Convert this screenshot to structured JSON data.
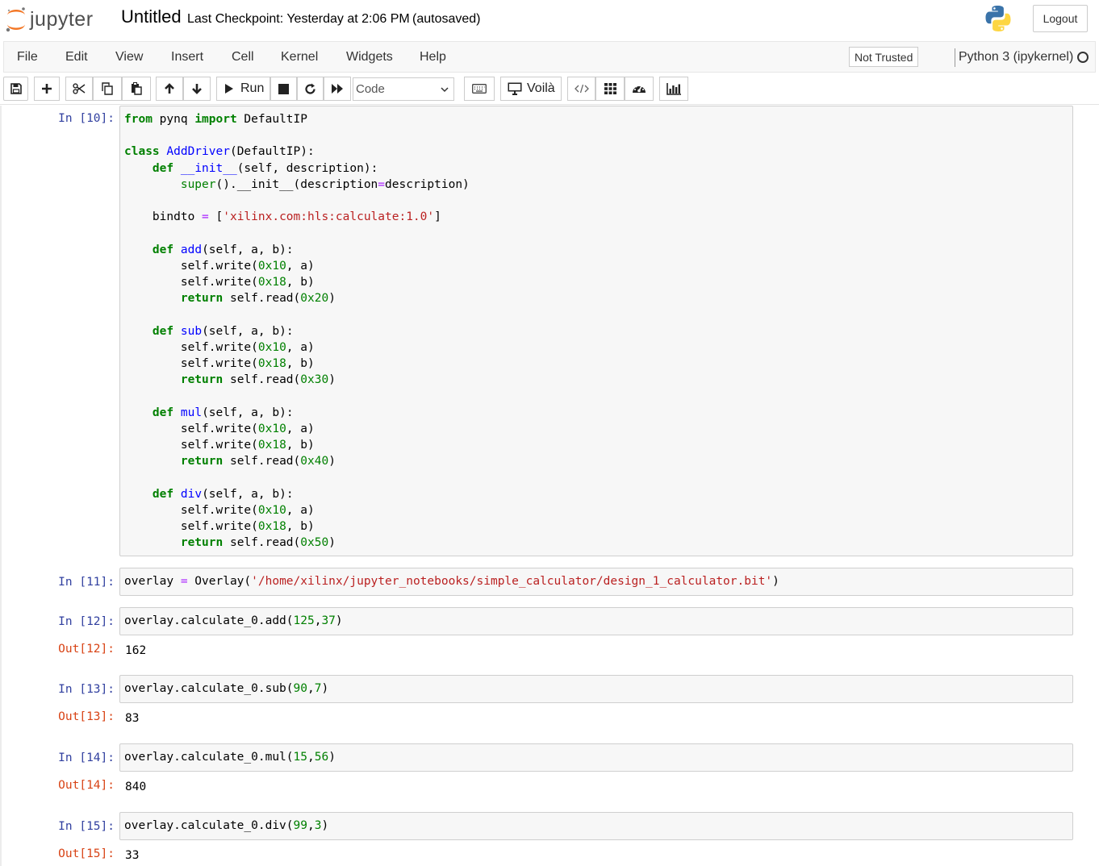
{
  "header": {
    "logo_text": "jupyter",
    "notebook_title": "Untitled",
    "checkpoint": "Last Checkpoint: Yesterday at 2:06 PM",
    "autosave": "(autosaved)",
    "logout_label": "Logout"
  },
  "menubar": {
    "items": [
      "File",
      "Edit",
      "View",
      "Insert",
      "Cell",
      "Kernel",
      "Widgets",
      "Help"
    ],
    "trust_status": "Not Trusted",
    "kernel_name": "Python 3 (ipykernel)"
  },
  "toolbar": {
    "run_label": "Run",
    "cell_type": "Code",
    "voila_label": "Voilà",
    "icons": [
      "save-icon",
      "plus-icon",
      "scissors-icon",
      "copy-icon",
      "paste-icon",
      "arrow-up-icon",
      "arrow-down-icon",
      "play-icon",
      "stop-icon",
      "restart-icon",
      "fast-forward-icon",
      "keyboard-icon",
      "monitor-icon",
      "code-icon",
      "grid-icon",
      "dashboard-icon",
      "bar-chart-icon"
    ]
  },
  "cells": [
    {
      "prompt": "In [10]:",
      "code": "from pynq import DefaultIP\n\nclass AddDriver(DefaultIP):\n    def __init__(self, description):\n        super().__init__(description=description)\n\n    bindto = ['xilinx.com:hls:calculate:1.0']\n\n    def add(self, a, b):\n        self.write(0x10, a)\n        self.write(0x18, b)\n        return self.read(0x20)\n\n    def sub(self, a, b):\n        self.write(0x10, a)\n        self.write(0x18, b)\n        return self.read(0x30)\n\n    def mul(self, a, b):\n        self.write(0x10, a)\n        self.write(0x18, b)\n        return self.read(0x40)\n\n    def div(self, a, b):\n        self.write(0x10, a)\n        self.write(0x18, b)\n        return self.read(0x50)"
    },
    {
      "prompt": "In [11]:",
      "code": "overlay = Overlay('/home/xilinx/jupyter_notebooks/simple_calculator/design_1_calculator.bit')"
    },
    {
      "prompt": "In [12]:",
      "code": "overlay.calculate_0.add(125,37)",
      "out_prompt": "Out[12]:",
      "output": "162"
    },
    {
      "prompt": "In [13]:",
      "code": "overlay.calculate_0.sub(90,7)",
      "out_prompt": "Out[13]:",
      "output": "83"
    },
    {
      "prompt": "In [14]:",
      "code": "overlay.calculate_0.mul(15,56)",
      "out_prompt": "Out[14]:",
      "output": "840"
    },
    {
      "prompt": "In [15]:",
      "code": "overlay.calculate_0.div(99,3)",
      "out_prompt": "Out[15]:",
      "output": "33"
    }
  ],
  "colors": {
    "in_prompt": "#303f9f",
    "out_prompt": "#d84315",
    "keyword": "#008000",
    "definition": "#0000ff",
    "string": "#ba2121",
    "number": "#008000",
    "operator": "#aa22ff",
    "logo_orange": "#f37726"
  }
}
